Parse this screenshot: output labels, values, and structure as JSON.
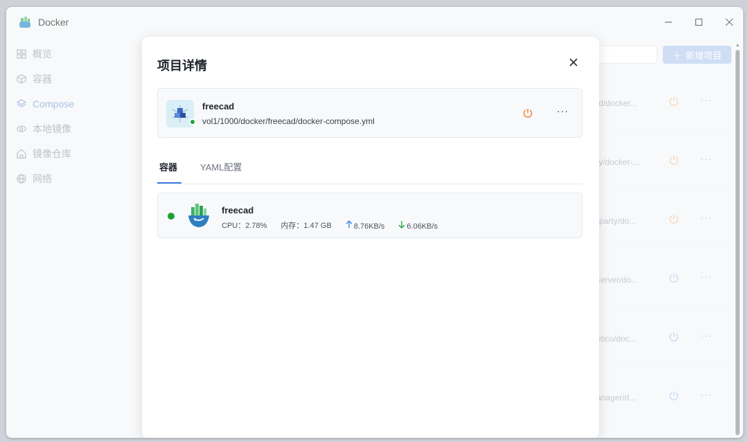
{
  "window": {
    "title": "Docker"
  },
  "sidebar": {
    "items": [
      {
        "label": "概览",
        "icon": "grid-icon"
      },
      {
        "label": "容器",
        "icon": "cube-icon"
      },
      {
        "label": "Compose",
        "icon": "layers-icon",
        "active": true
      },
      {
        "label": "本地镜像",
        "icon": "eye-icon"
      },
      {
        "label": "镜像仓库",
        "icon": "home-icon"
      },
      {
        "label": "网络",
        "icon": "globe-icon"
      }
    ]
  },
  "background": {
    "add_button_label": "新增项目",
    "rows": [
      {
        "path": "/d/docker..."
      },
      {
        "path": "/y/docker-..."
      },
      {
        "path": "-party/do..."
      },
      {
        "path": "server/do..."
      },
      {
        "path": "etico/doc..."
      },
      {
        "path": "anager/d..."
      }
    ]
  },
  "modal": {
    "title": "项目详情",
    "project": {
      "name": "freecad",
      "path": "vol1/1000/docker/freecad/docker-compose.yml",
      "status_color": "#1aa33a"
    },
    "tabs": [
      {
        "label": "容器",
        "active": true
      },
      {
        "label": "YAML配置",
        "active": false
      }
    ],
    "containers": [
      {
        "name": "freecad",
        "cpu": "CPU：2.78%",
        "memory": "内存：1.47 GB",
        "upload": "8.76KB/s",
        "download": "6.06KB/s",
        "status_color": "#1aa33a"
      }
    ]
  },
  "colors": {
    "accent": "#3d7be0",
    "power_active": "#e8833a",
    "power_faded": "#f0c496",
    "power_idle": "#a9c8ee"
  }
}
